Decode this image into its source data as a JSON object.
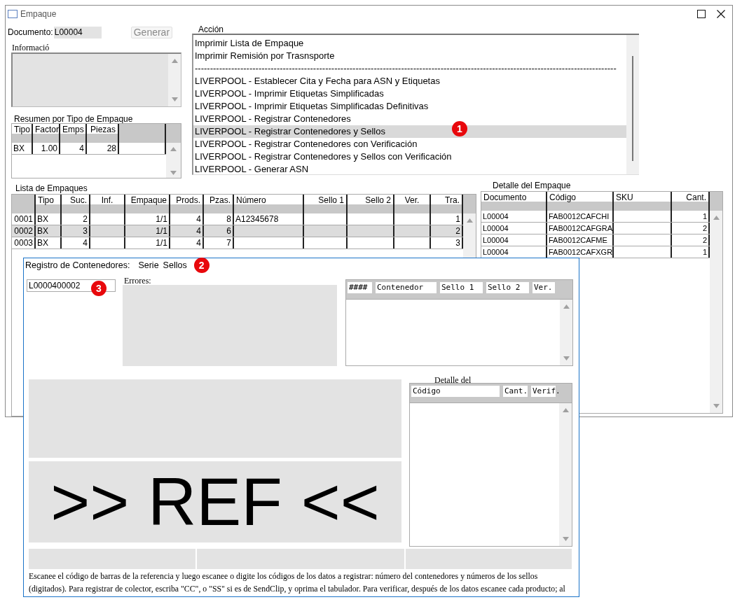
{
  "window": {
    "title": "Empaque"
  },
  "document": {
    "label": "Documento:",
    "value": "L00004"
  },
  "generate_button": {
    "label": "Generar",
    "disabled": true
  },
  "info": {
    "label": "Informació"
  },
  "summary": {
    "title": "Resumen por Tipo de Empaque",
    "columns": [
      {
        "label": "Tipo"
      },
      {
        "label": "Factor"
      },
      {
        "label": "Emps"
      },
      {
        "label": "Piezas"
      },
      {}
    ],
    "rows": [
      {
        "cells": [
          "BX",
          "1.00",
          "4",
          "28",
          ""
        ],
        "selected": false
      }
    ]
  },
  "action": {
    "label": "Acción",
    "items": [
      {
        "text": "Imprimir Lista de Empaque",
        "selected": false
      },
      {
        "text": "Imprimir Remisión por Trasnsporte",
        "selected": false
      },
      {
        "text": "-------------------------------------------------------------------------------------------------------------------------------------------",
        "selected": false
      },
      {
        "text": "LIVERPOOL - Establecer Cita y Fecha para ASN y Etiquetas",
        "selected": false
      },
      {
        "text": "LIVERPOOL - Imprimir Etiquetas Simplificadas",
        "selected": false
      },
      {
        "text": "LIVERPOOL - Imprimir Etiquetas Simplificadas Definitivas",
        "selected": false
      },
      {
        "text": "LIVERPOOL - Registrar Contenedores",
        "selected": false
      },
      {
        "text": "LIVERPOOL - Registrar Contenedores y Sellos",
        "selected": true
      },
      {
        "text": "LIVERPOOL - Registrar Contenedores con Verificación",
        "selected": false
      },
      {
        "text": "LIVERPOOL - Registrar Contenedores y Sellos con Verificación",
        "selected": false
      },
      {
        "text": "LIVERPOOL - Generar ASN",
        "selected": false
      }
    ]
  },
  "packages": {
    "title": "Lista de Empaques",
    "columns": [
      {},
      {
        "label": "Tipo"
      },
      {
        "label": "Suc."
      },
      {
        "label": "Inf."
      },
      {
        "label": "Empaque"
      },
      {
        "label": "Prods."
      },
      {
        "label": "Pzas."
      },
      {
        "label": "Número"
      },
      {
        "label": "Sello 1"
      },
      {
        "label": "Sello 2"
      },
      {
        "label": "Ver."
      },
      {
        "label": "Tra."
      }
    ],
    "rows": [
      {
        "cells": [
          "0001",
          "BX",
          "2",
          "",
          "1/1",
          "4",
          "8",
          "A12345678",
          "",
          "",
          "",
          "1"
        ],
        "selected": false
      },
      {
        "cells": [
          "0002",
          "BX",
          "3",
          "",
          "1/1",
          "4",
          "6",
          "",
          "",
          "",
          "",
          "2"
        ],
        "selected": true
      },
      {
        "cells": [
          "0003",
          "BX",
          "4",
          "",
          "1/1",
          "4",
          "7",
          "",
          "",
          "",
          "",
          "3"
        ],
        "selected": false
      }
    ]
  },
  "detail": {
    "title": "Detalle del Empaque",
    "columns": [
      {
        "label": "Documento"
      },
      {
        "label": "Código"
      },
      {
        "label": "SKU"
      },
      {
        "label": "Cant."
      }
    ],
    "rows": [
      {
        "cells": [
          "L00004",
          "FAB0012CAFCHI",
          "",
          "1"
        ],
        "selected": false
      },
      {
        "cells": [
          "L00004",
          "FAB0012CAFGRA",
          "",
          "2"
        ],
        "selected": false
      },
      {
        "cells": [
          "L00004",
          "FAB0012CAFME",
          "",
          "2"
        ],
        "selected": false
      },
      {
        "cells": [
          "L00004",
          "FAB0012CAFXGR",
          "",
          "1"
        ],
        "selected": false
      }
    ]
  },
  "dialog": {
    "title": "Registro de Contenedores:",
    "menu": [
      "Serie",
      "Sellos"
    ],
    "input_value": "L0000400002",
    "errors_label": "Errores:",
    "containers_columns": [
      "####",
      "Contenedor",
      "Sello 1",
      "Sello 2",
      "Ver."
    ],
    "ref_text": ">> REF <<",
    "detail_title": "Detalle del",
    "detail_columns": [
      "Código",
      "Cant.",
      "Verif."
    ],
    "help_text": "Escanee el código de barras de la referencia y luego escanee o digite los códigos de los datos a registrar: número del contenedores y números de los sellos (digitados). Para registrar de colector, escriba \"CC\", o \"SS\" si es de SendClip, y oprima el tabulador. Para verificar, después de los datos escanee cada producto; al"
  },
  "annotations": [
    "1",
    "2",
    "3"
  ]
}
